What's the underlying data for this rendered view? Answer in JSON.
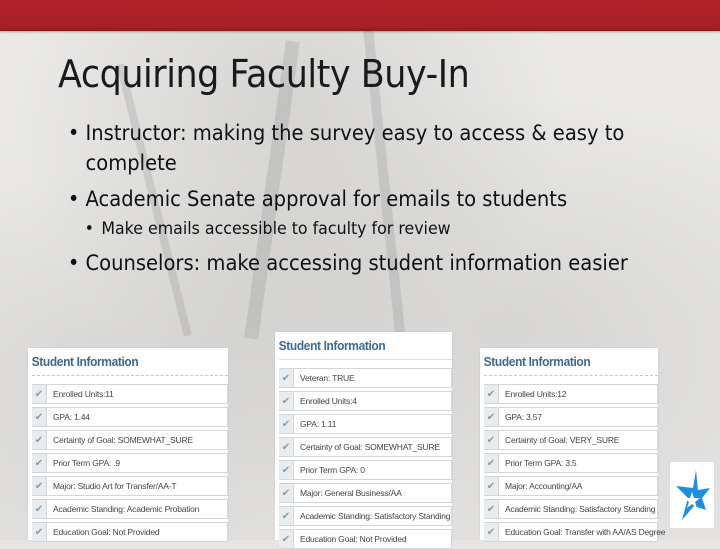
{
  "slide": {
    "title": "Acquiring Faculty Buy-In",
    "bullets": [
      {
        "text": "Instructor: making the survey easy to access & easy to complete",
        "level": 1
      },
      {
        "text": "Academic Senate approval for emails to students",
        "level": 1
      },
      {
        "text": "Make emails accessible to faculty for review",
        "level": 2
      },
      {
        "text": "Counselors: make accessing student information easier",
        "level": 1
      }
    ],
    "accent_color": "#b3222b",
    "panel_title_color": "#3d6a8f"
  },
  "panels": [
    {
      "title": "Student Information",
      "items": [
        "Enrolled Units:11",
        "GPA: 1.44",
        "Certainty of Goal: SOMEWHAT_SURE",
        "Prior Term GPA: .9",
        "Major: Studio Art for Transfer/AA-T",
        "Academic Standing: Academic Probation",
        "Education Goal: Not Provided"
      ]
    },
    {
      "title": "Student Information",
      "items": [
        "Veteran: TRUE",
        "Enrolled Units:4",
        "GPA: 1.11",
        "Certainty of Goal: SOMEWHAT_SURE",
        "Prior Term GPA: 0",
        "Major: General Business/AA",
        "Academic Standing: Satisfactory Standing",
        "Education Goal: Not Provided"
      ]
    },
    {
      "title": "Student Information",
      "items": [
        "Enrolled Units:12",
        "GPA: 3.57",
        "Certainty of Goal: VERY_SURE",
        "Prior Term GPA: 3.5",
        "Major: Accounting/AA",
        "Academic Standing: Satisfactory Standing",
        "Education Goal: Transfer with AA/AS Degree"
      ]
    }
  ],
  "icons": {
    "check": "✔",
    "logo": "star-logo-icon"
  }
}
